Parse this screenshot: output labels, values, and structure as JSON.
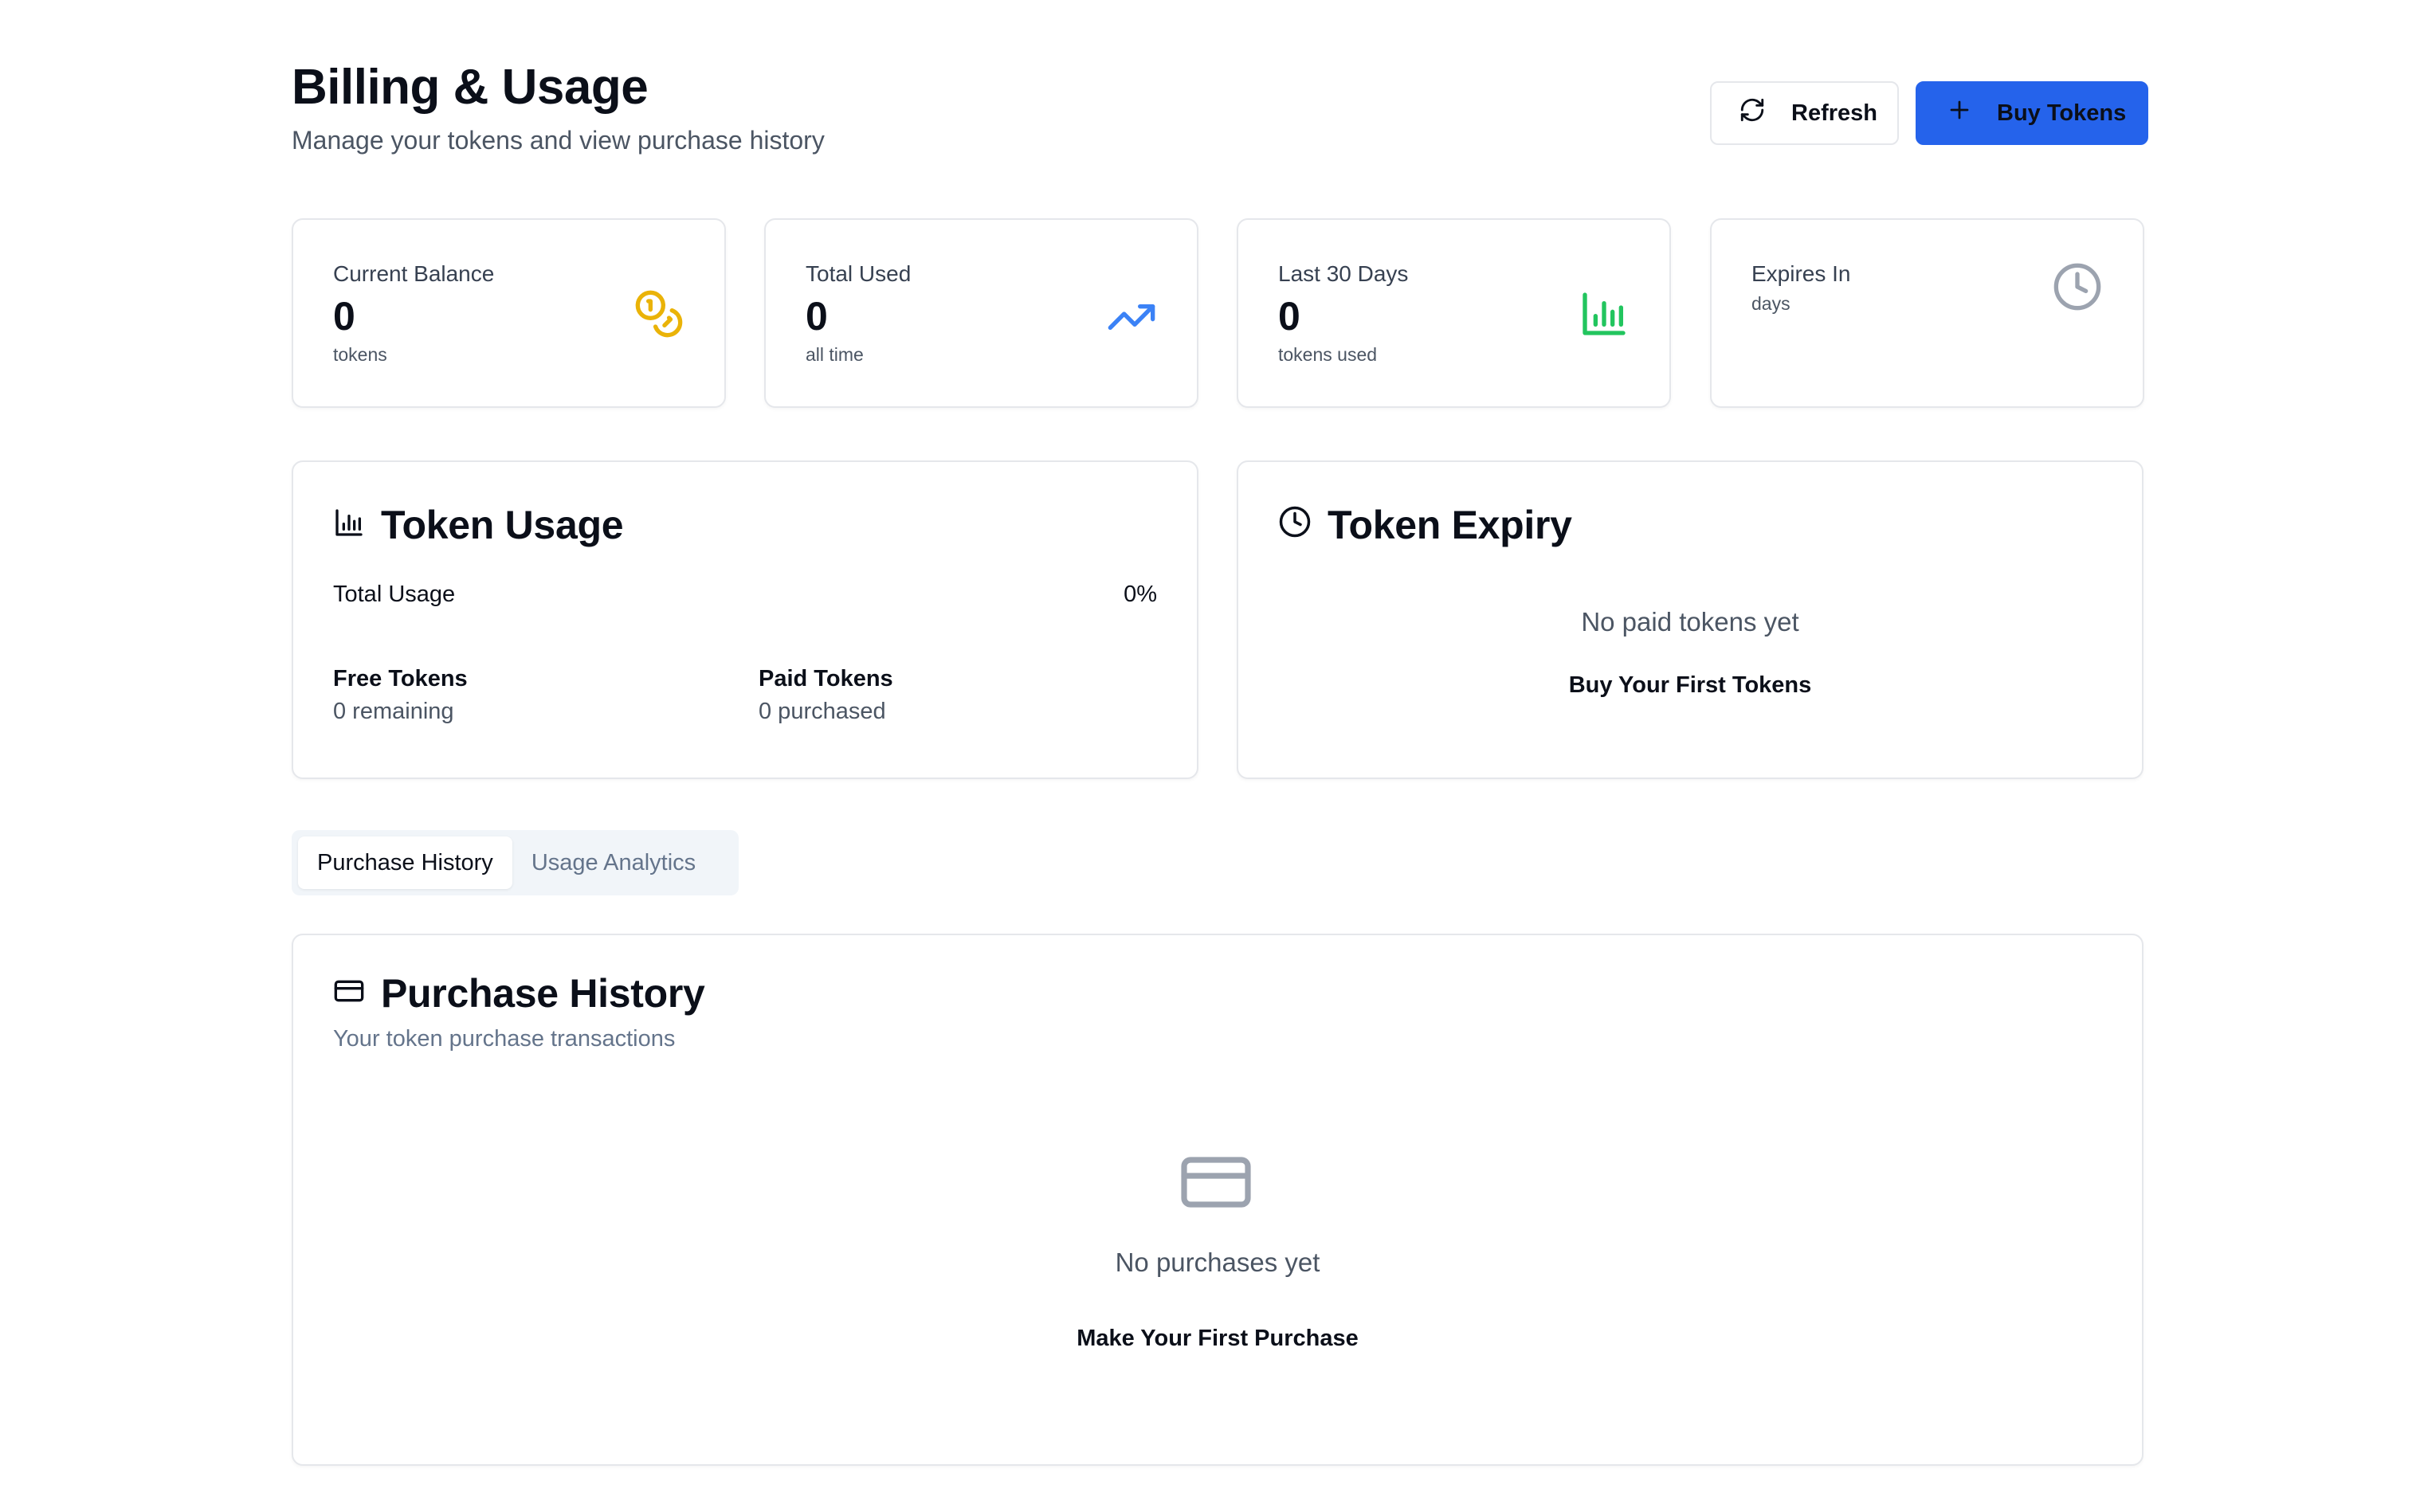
{
  "header": {
    "title": "Billing & Usage",
    "subtitle": "Manage your tokens and view purchase history",
    "refresh_label": "Refresh",
    "buy_label": "Buy Tokens"
  },
  "stats": [
    {
      "label": "Current Balance",
      "value": "0",
      "unit": "tokens",
      "icon": "coins-icon",
      "color": "#eab308"
    },
    {
      "label": "Total Used",
      "value": "0",
      "unit": "all time",
      "icon": "trending-up-icon",
      "color": "#3b82f6"
    },
    {
      "label": "Last 30 Days",
      "value": "0",
      "unit": "tokens used",
      "icon": "bar-chart-icon",
      "color": "#22c55e"
    },
    {
      "label": "Expires In",
      "value": "",
      "unit": "days",
      "icon": "clock-icon",
      "color": "#9ca3af"
    }
  ],
  "token_usage": {
    "title": "Token Usage",
    "total_label": "Total Usage",
    "total_value": "0%",
    "free_title": "Free Tokens",
    "free_sub": "0 remaining",
    "paid_title": "Paid Tokens",
    "paid_sub": "0 purchased"
  },
  "token_expiry": {
    "title": "Token Expiry",
    "empty_message": "No paid tokens yet",
    "cta": "Buy Your First Tokens"
  },
  "tabs": [
    {
      "label": "Purchase History",
      "active": true
    },
    {
      "label": "Usage Analytics",
      "active": false
    }
  ],
  "purchase_history": {
    "title": "Purchase History",
    "subtitle": "Your token purchase transactions",
    "empty_message": "No purchases yet",
    "cta": "Make Your First Purchase"
  },
  "colors": {
    "primary": "#2563eb",
    "border": "#e5e7eb",
    "muted": "#64748b"
  }
}
